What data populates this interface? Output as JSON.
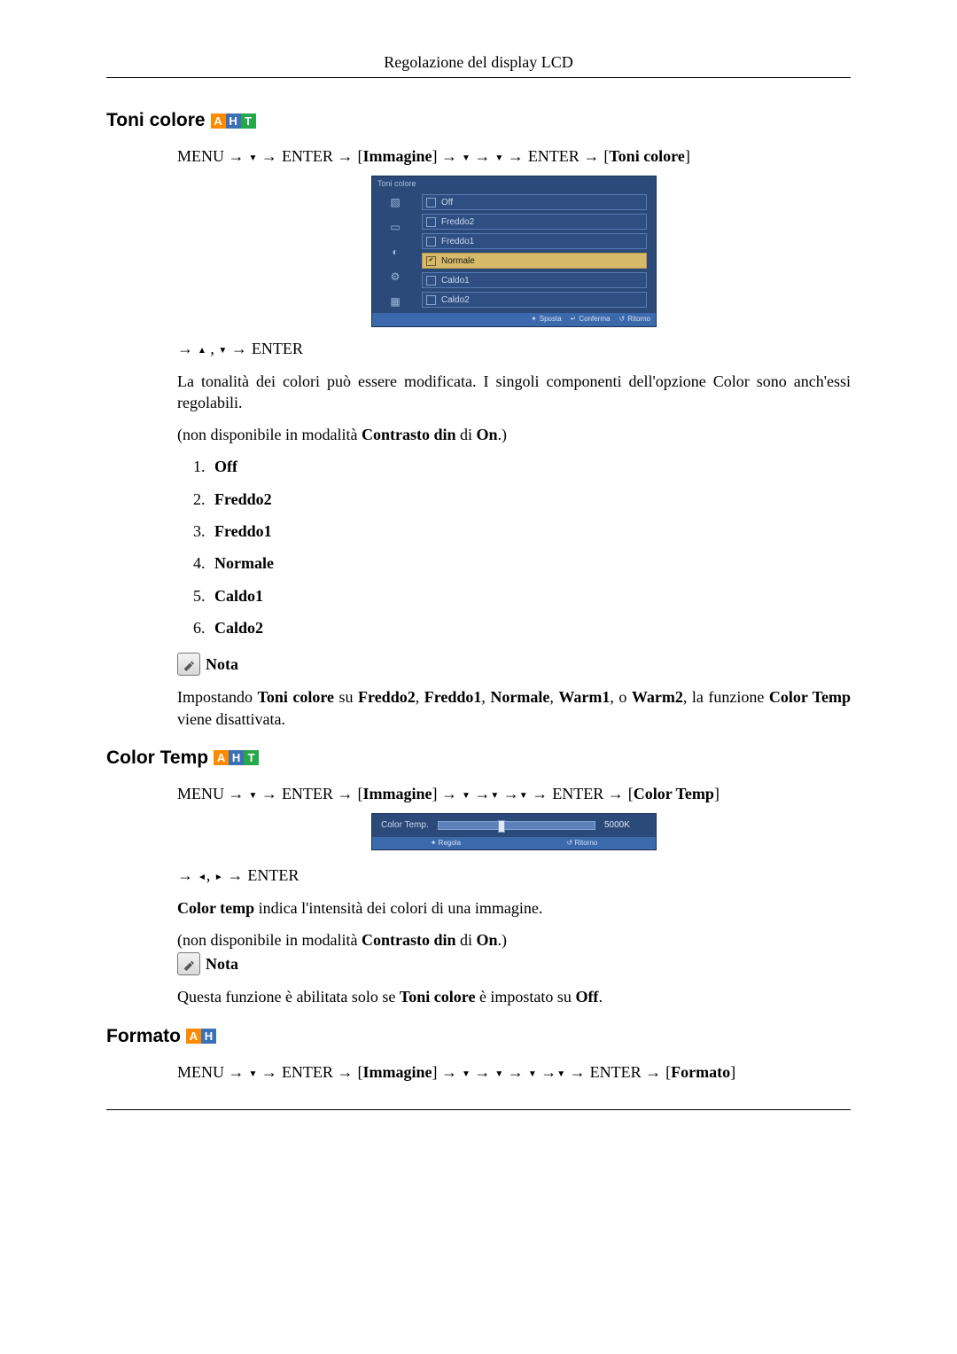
{
  "header": {
    "title": "Regolazione del display LCD"
  },
  "badges": {
    "a": "A",
    "h": "H",
    "t": "T"
  },
  "sections": {
    "toni": {
      "title": "Toni colore",
      "nav": {
        "m": "MENU",
        "e1": "ENTER",
        "menu1": "Immagine",
        "e2": "ENTER",
        "target": "Toni colore"
      },
      "osd": {
        "title": "Toni colore",
        "items": [
          "Off",
          "Freddo2",
          "Freddo1",
          "Normale",
          "Caldo1",
          "Caldo2"
        ],
        "selectedIndex": 3,
        "foot": {
          "move": "Sposta",
          "confirm": "Conferma",
          "return": "Ritorno"
        }
      },
      "nav2": {
        "e": "ENTER"
      },
      "desc": "La tonalità dei colori può essere modificata. I singoli componenti dell'opzione Color sono anch'essi regolabili.",
      "unavail_a": "(non disponibile in modalità ",
      "unavail_b": "Contrasto din",
      "unavail_c": " di ",
      "unavail_d": "On",
      "unavail_e": ".)",
      "list": [
        "Off",
        "Freddo2",
        "Freddo1",
        "Normale",
        "Caldo1",
        "Caldo2"
      ],
      "note_label": "Nota",
      "note_a": "Impostando ",
      "note_b": "Toni colore",
      "note_c": " su ",
      "note_d": "Freddo2",
      "note_e": ", ",
      "note_f": "Freddo1",
      "note_g": ", ",
      "note_h": "Normale",
      "note_i": ", ",
      "note_j": "Warm1",
      "note_k": ", o ",
      "note_l": "Warm2",
      "note_m": ", la funzione ",
      "note_n": "Color Temp",
      "note_o": " viene disattivata."
    },
    "ctemp": {
      "title": "Color Temp",
      "nav": {
        "m": "MENU",
        "e1": "ENTER",
        "menu1": "Immagine",
        "e2": "ENTER",
        "target": "Color Temp"
      },
      "osd": {
        "label": "Color  Temp.",
        "value": "5000K",
        "foot": {
          "adjust": "Regola",
          "return": "Ritorno"
        }
      },
      "nav2": {
        "e": "ENTER"
      },
      "desc_a": "Color temp",
      "desc_b": " indica l'intensità dei colori di una immagine.",
      "unavail_a": "(non disponibile in modalità ",
      "unavail_b": "Contrasto din",
      "unavail_c": " di ",
      "unavail_d": "On",
      "unavail_e": ".)",
      "note_label": "Nota",
      "note_a": "Questa funzione è abilitata solo se ",
      "note_b": "Toni colore",
      "note_c": " è impostato su ",
      "note_d": "Off",
      "note_e": "."
    },
    "formato": {
      "title": "Formato",
      "nav": {
        "m": "MENU",
        "e1": "ENTER",
        "menu1": "Immagine",
        "e2": "ENTER",
        "target": "Formato"
      }
    }
  }
}
